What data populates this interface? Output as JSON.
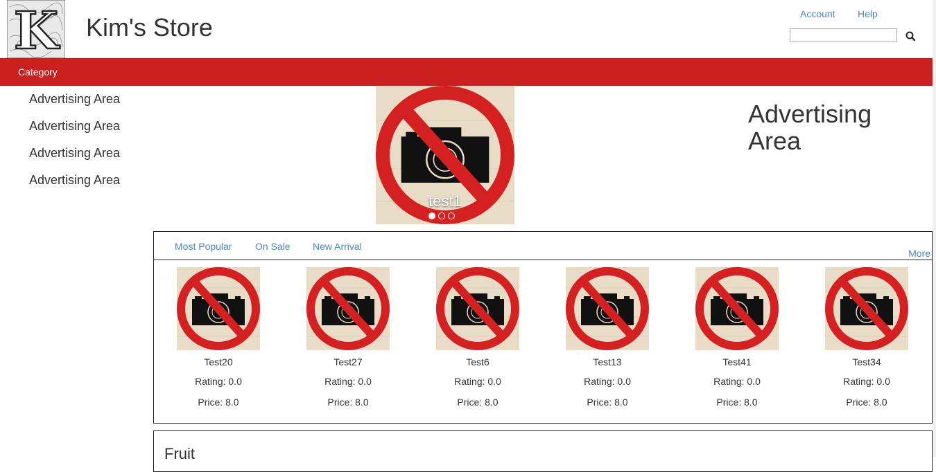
{
  "header": {
    "logo_letter": "K",
    "store_name": "Kim's Store",
    "links": {
      "account": "Account",
      "help": "Help"
    },
    "search": {
      "placeholder": "",
      "value": ""
    }
  },
  "nav": {
    "category_label": "Category"
  },
  "side_ads": [
    "Advertising Area",
    "Advertising Area",
    "Advertising Area",
    "Advertising Area"
  ],
  "carousel": {
    "caption": "test1",
    "slides": 3,
    "active_slide": 1
  },
  "right_ad": "Advertising Area",
  "product_tabs": {
    "tabs": [
      "Most Popular",
      "On Sale",
      "New Arrival"
    ],
    "more": "More"
  },
  "products": [
    {
      "name": "Test20",
      "rating": "Rating: 0.0",
      "price": "Price: 8.0"
    },
    {
      "name": "Test27",
      "rating": "Rating: 0.0",
      "price": "Price: 8.0"
    },
    {
      "name": "Test6",
      "rating": "Rating: 0.0",
      "price": "Price: 8.0"
    },
    {
      "name": "Test13",
      "rating": "Rating: 0.0",
      "price": "Price: 8.0"
    },
    {
      "name": "Test41",
      "rating": "Rating: 0.0",
      "price": "Price: 8.0"
    },
    {
      "name": "Test34",
      "rating": "Rating: 0.0",
      "price": "Price: 8.0"
    }
  ],
  "sections": {
    "fruit_title": "Fruit"
  },
  "colors": {
    "brand_red": "#cc1f1f",
    "link_blue": "#4a86c5",
    "no_photo_red": "#d42020",
    "no_photo_bg": "#e8dcc6"
  }
}
